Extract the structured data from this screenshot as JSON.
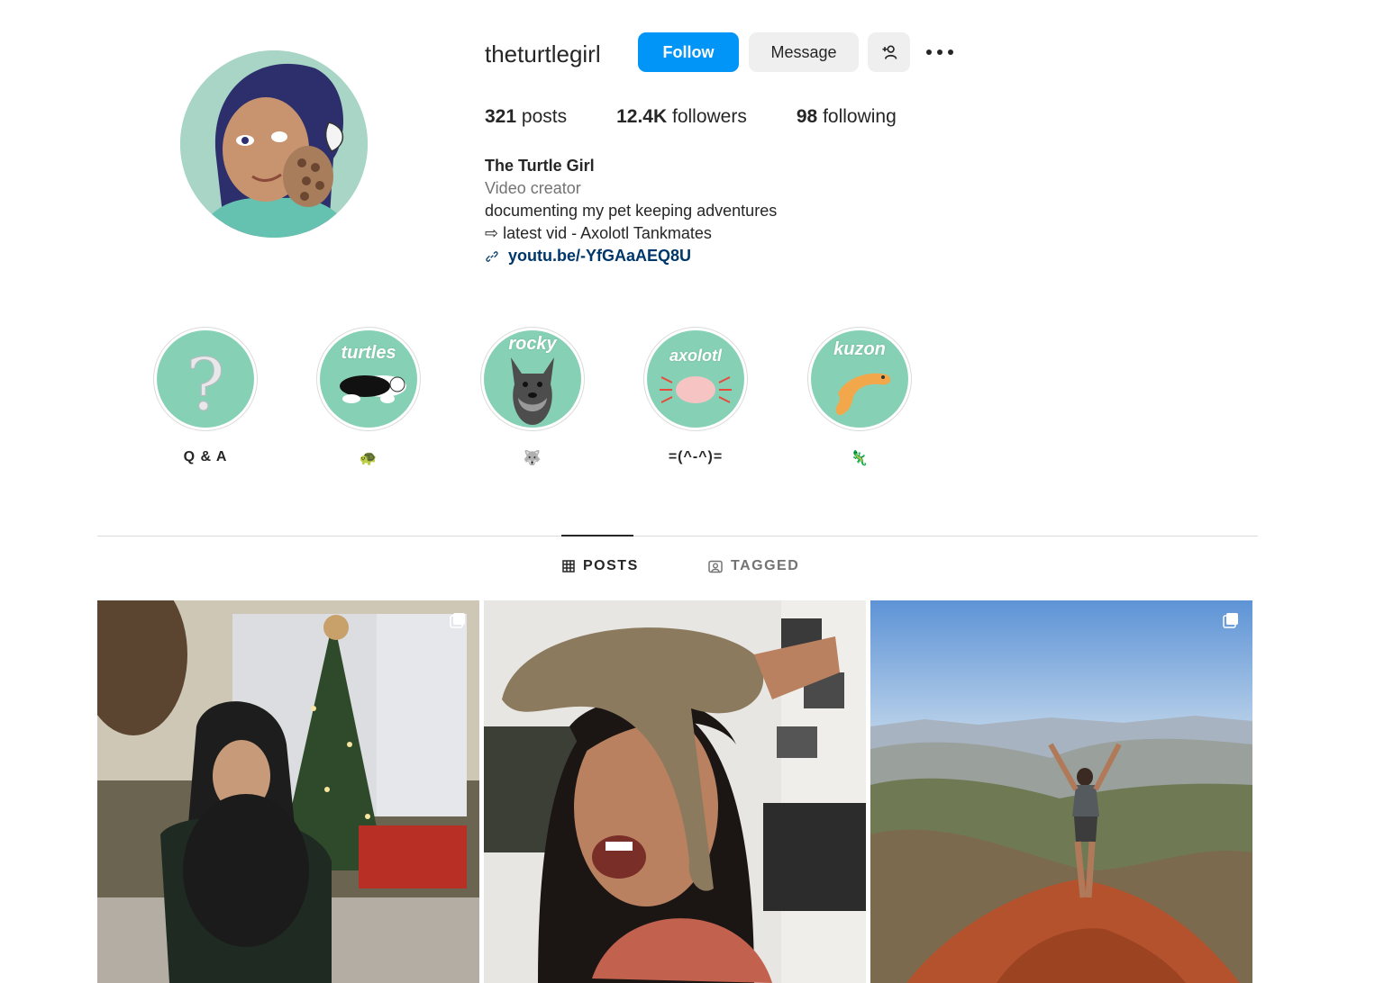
{
  "profile": {
    "username": "theturtlegirl",
    "follow_label": "Follow",
    "message_label": "Message",
    "stats": {
      "posts_count": "321",
      "posts_label": "posts",
      "followers_count": "12.4K",
      "followers_label": "followers",
      "following_count": "98",
      "following_label": "following"
    },
    "bio": {
      "name": "The Turtle Girl",
      "category": "Video creator",
      "line1": "documenting my pet keeping adventures",
      "line2": "⇨ latest vid - Axolotl Tankmates",
      "link": "youtu.be/-YfGAaAEQ8U"
    }
  },
  "highlights": [
    {
      "label": "Q & A",
      "cover_text": "?"
    },
    {
      "label": "🐢",
      "cover_text": "turtles"
    },
    {
      "label": "🐺",
      "cover_text": "rocky"
    },
    {
      "label": "=(^-^)=",
      "cover_text": "axolotl"
    },
    {
      "label": "🦎",
      "cover_text": "kuzon"
    }
  ],
  "tabs": {
    "posts": "POSTS",
    "tagged": "TAGGED",
    "active": "posts"
  },
  "colors": {
    "primary_button": "#0095f6",
    "secondary_button": "#efefef",
    "link": "#00376b",
    "highlight_bg": "#86d1b6"
  },
  "icons": {
    "add_user": "add-person-icon",
    "more": "more-options-icon",
    "link": "link-icon",
    "grid": "grid-icon",
    "tagged": "tagged-icon",
    "multi_post": "carousel-icon"
  }
}
